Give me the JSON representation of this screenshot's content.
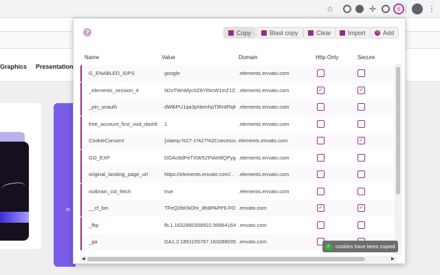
{
  "browser": {
    "toolbar_icons": [
      "star-icon",
      "refresh-extension-icon",
      "check-extension-icon",
      "compass-icon",
      "eye-extension-icon",
      "cookie-editor-icon",
      "profile-avatar-icon",
      "menu-icon"
    ]
  },
  "background_page": {
    "nav": [
      "Graphics",
      "Presentation T"
    ],
    "purple_card_text": "In"
  },
  "popup": {
    "help_label": "?",
    "buttons": {
      "copy": "Copy",
      "blast_copy": "Blast copy",
      "clear": "Clear",
      "import": "Import",
      "add": "Add"
    },
    "columns": {
      "name": "Name",
      "value": "Value",
      "domain": "Domain",
      "http_only": "Http Only",
      "secure": "Secure"
    },
    "cookies": [
      {
        "name": "G_ENABLED_IDPS",
        "value": "google",
        "domain": ".elements.envato.com",
        "http_only": false,
        "secure": false
      },
      {
        "name": "_elements_session_4",
        "value": "N2xTWnMyc0Z8YlhlcW1mZ1Z...",
        "domain": ".elements.envato.com",
        "http_only": true,
        "secure": true
      },
      {
        "name": "_pin_unauth",
        "value": "dWlkPU1qa3pNemhpTlRrdFlqMm...",
        "domain": ".elements.envato.com",
        "http_only": false,
        "secure": false
      },
      {
        "name": "free_account_first_visit_dashboard",
        "value": "1",
        "domain": ".elements.envato.com",
        "http_only": false,
        "secure": false
      },
      {
        "name": "CookieConsent",
        "value": "{stamp:%27-1%27%2Cnecessary...",
        "domain": "elements.envato.com",
        "http_only": false,
        "secure": true
      },
      {
        "name": "GO_EXP",
        "value": "DOAc8dPeTXWS2PtAH9QPyg...",
        "domain": ".elements.envato.com",
        "http_only": false,
        "secure": false
      },
      {
        "name": "original_landing_page_url",
        "value": "https://elements.envato.com/...",
        "domain": ".elements.envato.com",
        "http_only": false,
        "secure": false
      },
      {
        "name": "outbrain_cid_fetch",
        "value": "true",
        "domain": ".elements.envato.com",
        "http_only": false,
        "secure": false
      },
      {
        "name": "__cf_bm",
        "value": "TFeQ2bKNOhr_8h8PAPP6.FO...",
        "domain": ".envato.com",
        "http_only": true,
        "secure": true
      },
      {
        "name": "_fbp",
        "value": "fb.1.1632880358922.968641642",
        "domain": ".envato.com",
        "http_only": false,
        "secure": false
      },
      {
        "name": "_ga",
        "value": "GA1.2.1851155787.1632880358",
        "domain": ".envato.com",
        "http_only": false,
        "secure": false
      }
    ],
    "toast": "cookies have been copied"
  }
}
